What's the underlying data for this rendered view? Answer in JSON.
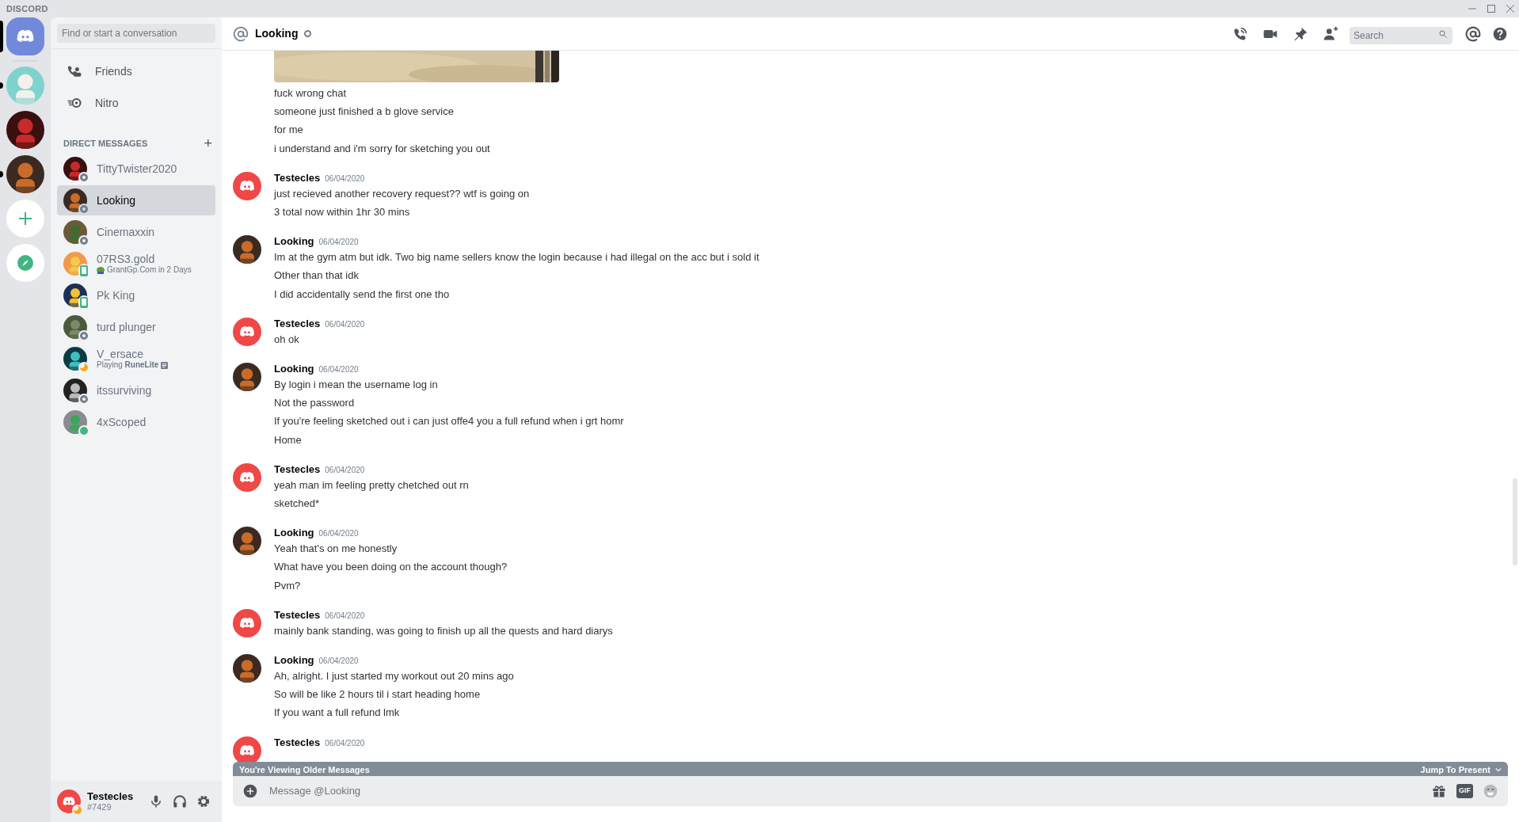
{
  "app": {
    "title": "DISCORD"
  },
  "servers": [
    {
      "selected": true,
      "kind": "home"
    },
    {
      "selected": false,
      "kind": "picture",
      "unread": true
    },
    {
      "selected": false,
      "kind": "picture",
      "unread": false
    },
    {
      "selected": false,
      "kind": "picture",
      "unread": true
    },
    {
      "selected": false,
      "kind": "add"
    },
    {
      "selected": false,
      "kind": "explore"
    }
  ],
  "sidebar": {
    "search_placeholder": "Find or start a conversation",
    "nav": [
      {
        "label": "Friends",
        "kind": "friends"
      },
      {
        "label": "Nitro",
        "kind": "nitro"
      }
    ],
    "section_title": "DIRECT MESSAGES",
    "section_action": "+",
    "dms": [
      {
        "name": "TittyTwister2020",
        "kind": "offline",
        "selected": false
      },
      {
        "name": "Looking",
        "kind": "offline",
        "selected": true
      },
      {
        "name": "Cinemaxxin",
        "kind": "offline",
        "selected": false
      },
      {
        "name": "07RS3.gold",
        "kind": "mobile",
        "selected": false,
        "activity": {
          "kind": "emoji",
          "text": "GrantGp.Com in 2 Days"
        }
      },
      {
        "name": "Pk King",
        "kind": "mobile",
        "selected": false
      },
      {
        "name": "turd plunger",
        "kind": "offline",
        "selected": false
      },
      {
        "name": "V_ersace",
        "kind": "idle",
        "selected": false,
        "activity": {
          "kind": "game",
          "text": "Playing **RuneLite**"
        }
      },
      {
        "name": "itssurviving",
        "kind": "offline",
        "selected": false
      },
      {
        "name": "4xScoped",
        "kind": "online",
        "selected": false
      }
    ]
  },
  "user_panel": {
    "name": "Testecles",
    "tag": "#7429",
    "idle": true
  },
  "header": {
    "channel": "Looking",
    "online": false,
    "search_placeholder": "Search"
  },
  "messages": [
    {
      "kind": "continuation",
      "image": true,
      "lines": [
        "fuck wrong chat",
        "someone just finished a b glove service",
        "for me",
        "i understand and i'm sorry for sketching you out"
      ]
    },
    {
      "kind": "group",
      "author": "Testecles",
      "avatar": {
        "kind": "logo"
      },
      "date": "06/04/2020",
      "lines": [
        "just recieved another recovery request?? wtf is going on",
        "3 total now within 1hr 30 mins"
      ]
    },
    {
      "kind": "group",
      "author": "Looking",
      "avatar": {
        "kind": "picture"
      },
      "date": "06/04/2020",
      "lines": [
        "Im at the gym atm but idk. Two big name sellers know the login because i had illegal on the acc but i sold it",
        "Other than that idk",
        "I did accidentally send the first one tho"
      ]
    },
    {
      "kind": "group",
      "author": "Testecles",
      "avatar": {
        "kind": "logo"
      },
      "date": "06/04/2020",
      "lines": [
        "oh ok"
      ]
    },
    {
      "kind": "group",
      "author": "Looking",
      "avatar": {
        "kind": "picture"
      },
      "date": "06/04/2020",
      "lines": [
        "By login i mean the username log in",
        "Not the password",
        "If you're feeling sketched out i can just offe4 you a full refund when i grt homr",
        "Home"
      ]
    },
    {
      "kind": "group",
      "author": "Testecles",
      "avatar": {
        "kind": "logo"
      },
      "date": "06/04/2020",
      "lines": [
        "yeah man im feeling pretty chetched out rn",
        "sketched*"
      ]
    },
    {
      "kind": "group",
      "author": "Looking",
      "avatar": {
        "kind": "picture"
      },
      "date": "06/04/2020",
      "lines": [
        "Yeah that's on me honestly",
        "What have you been doing on the account though?",
        "Pvm?"
      ]
    },
    {
      "kind": "group",
      "author": "Testecles",
      "avatar": {
        "kind": "logo"
      },
      "date": "06/04/2020",
      "lines": [
        "mainly bank standing, was going to finish up all the quests and hard diarys"
      ]
    },
    {
      "kind": "group",
      "author": "Looking",
      "avatar": {
        "kind": "picture"
      },
      "date": "06/04/2020",
      "lines": [
        "Ah, alright. I just started my workout out 20 mins ago",
        "So will be like 2 hours til i start heading home",
        "If you want a full refund lmk"
      ]
    },
    {
      "kind": "group",
      "author": "Testecles",
      "avatar": {
        "kind": "logo"
      },
      "date": "06/04/2020"
    }
  ],
  "older_banner": {
    "text": "You're Viewing Older Messages",
    "action": "Jump To Present"
  },
  "composer": {
    "placeholder": "Message @Looking",
    "gif_label": "GIF"
  }
}
